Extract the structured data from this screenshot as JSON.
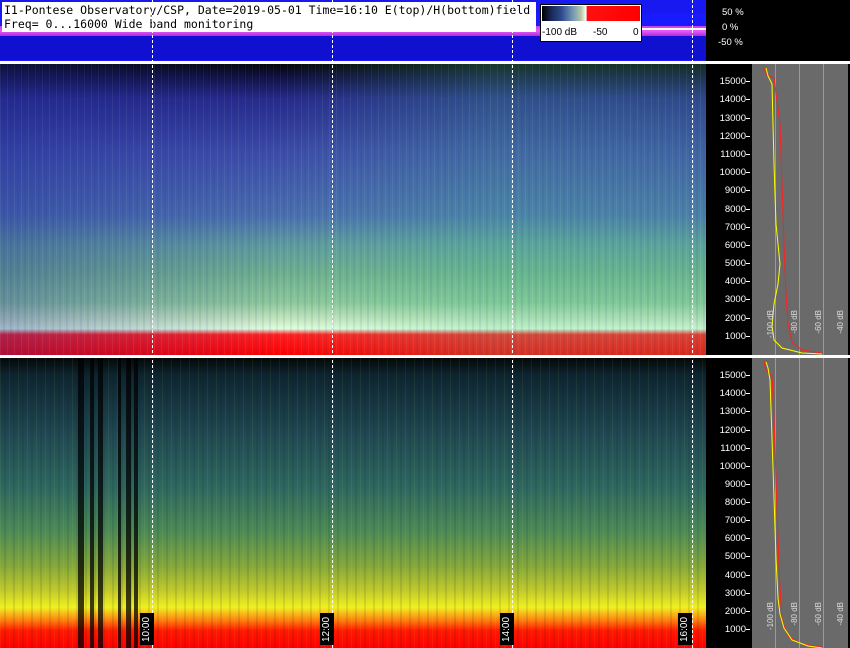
{
  "header": {
    "title_line": "I1-Pontese Observatory/CSP, Date=2019-05-01 Time=16:10 E(top)/H(bottom)field",
    "freq_line": "Freq= 0...16000 Wide band monitoring"
  },
  "colorbar": {
    "labels": [
      "-100 dB",
      "-50",
      "0"
    ]
  },
  "percent_axis": [
    "50 %",
    "0 %",
    "-50 %"
  ],
  "frequency_axis": [
    "15000",
    "14000",
    "13000",
    "12000",
    "11000",
    "10000",
    "9000",
    "8000",
    "7000",
    "6000",
    "5000",
    "4000",
    "3000",
    "2000",
    "1000"
  ],
  "time_axis": [
    "10:00",
    "12:00",
    "14:00",
    "16:00"
  ],
  "profile_db_labels": [
    "-100 dB",
    "-80 dB",
    "-60 dB",
    "-40 dB"
  ],
  "colors": {
    "e_field_low": "#2f3fa8",
    "e_field_mid": "#6fb08e",
    "h_field_low": "#1f4650",
    "h_field_mid": "#f0f020",
    "strong_signal": "#ff0000",
    "profile_bg": "#6a6a6a",
    "trace_mean": "#ffff00",
    "trace_max": "#ff2020"
  }
}
